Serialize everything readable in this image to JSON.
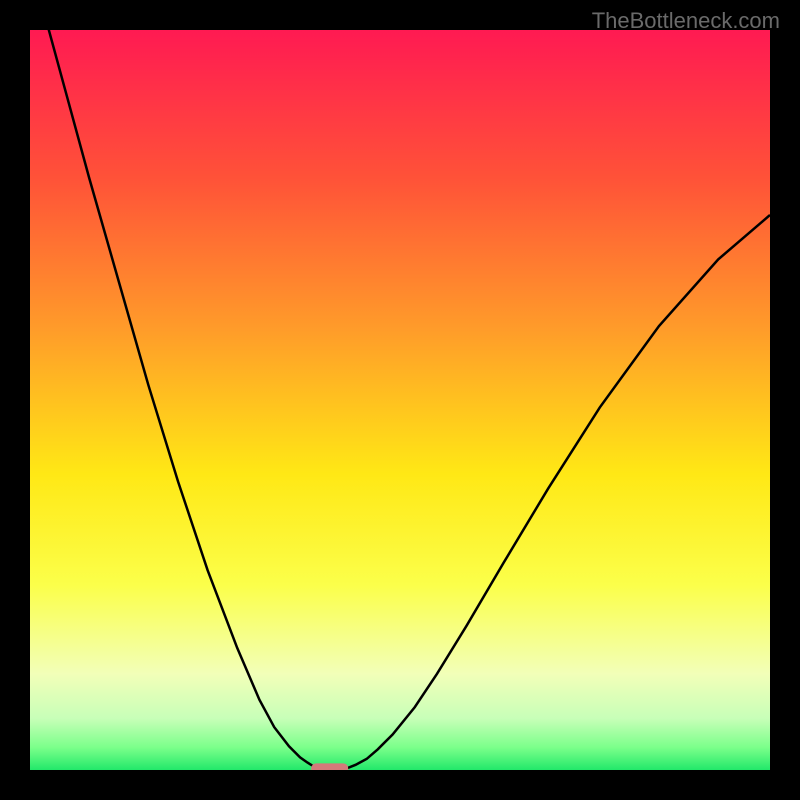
{
  "watermark": "TheBottleneck.com",
  "chart_data": {
    "type": "line",
    "title": "",
    "xlabel": "",
    "ylabel": "",
    "xlim": [
      0,
      100
    ],
    "ylim": [
      0,
      100
    ],
    "series": [
      {
        "name": "left-curve",
        "x": [
          0,
          2,
          5,
          8,
          12,
          16,
          20,
          24,
          28,
          31,
          33,
          35,
          36.5,
          37.5,
          38.3,
          39,
          39.5
        ],
        "y": [
          110,
          102,
          91,
          80,
          66,
          52,
          39,
          27,
          16.5,
          9.5,
          5.8,
          3.2,
          1.7,
          1.0,
          0.5,
          0.25,
          0.12
        ]
      },
      {
        "name": "right-curve",
        "x": [
          42,
          43,
          44,
          45.5,
          47,
          49,
          52,
          55,
          59,
          64,
          70,
          77,
          85,
          93,
          100
        ],
        "y": [
          0.12,
          0.3,
          0.7,
          1.5,
          2.8,
          4.8,
          8.5,
          13,
          19.5,
          28,
          38,
          49,
          60,
          69,
          75
        ]
      }
    ],
    "gradient_stops": [
      {
        "offset": 0,
        "color": "#ff1a52"
      },
      {
        "offset": 20,
        "color": "#ff5238"
      },
      {
        "offset": 40,
        "color": "#ff9a2a"
      },
      {
        "offset": 60,
        "color": "#ffe815"
      },
      {
        "offset": 75,
        "color": "#fbff4a"
      },
      {
        "offset": 87,
        "color": "#f2ffb8"
      },
      {
        "offset": 93,
        "color": "#c8ffb8"
      },
      {
        "offset": 97,
        "color": "#7aff8a"
      },
      {
        "offset": 100,
        "color": "#22e86a"
      }
    ],
    "marker": {
      "x": 40.5,
      "y": 0,
      "width": 5,
      "height": 1.8,
      "color": "#d47a7a"
    }
  }
}
